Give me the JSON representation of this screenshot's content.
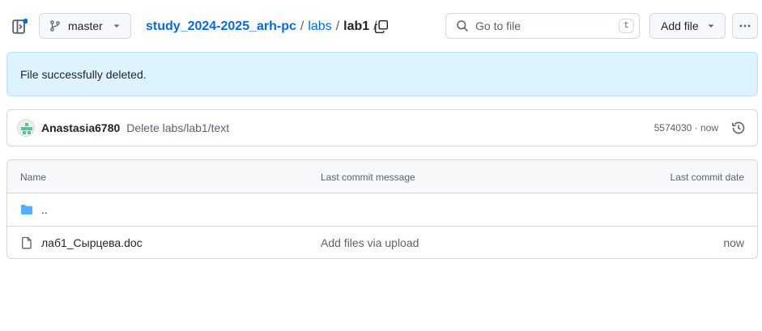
{
  "toolbar": {
    "branch": "master",
    "breadcrumb": {
      "repo": "study_2024-2025_arh-pc",
      "folder": "labs",
      "current": "lab1",
      "separator": "/"
    },
    "search": {
      "placeholder": "Go to file",
      "shortcut": "t"
    },
    "add_file_label": "Add file"
  },
  "flash": {
    "message": "File successfully deleted."
  },
  "latest_commit": {
    "author": "Anastasia6780",
    "message": "Delete labs/lab1/text",
    "sha": "5574030",
    "time": "now",
    "meta": "5574030 · now"
  },
  "file_table": {
    "columns": [
      "Name",
      "Last commit message",
      "Last commit date"
    ],
    "rows": [
      {
        "name": "..",
        "type": "folder-up",
        "message": "",
        "date": ""
      },
      {
        "name": "лаб1_Сырцева.doc",
        "type": "file",
        "message": "Add files via upload",
        "date": "now"
      }
    ]
  },
  "colors": {
    "link": "#0969da",
    "flash_bg": "#ddf4ff",
    "border": "#d1d9e0",
    "muted": "#59636e",
    "folder": "#54aeff"
  }
}
